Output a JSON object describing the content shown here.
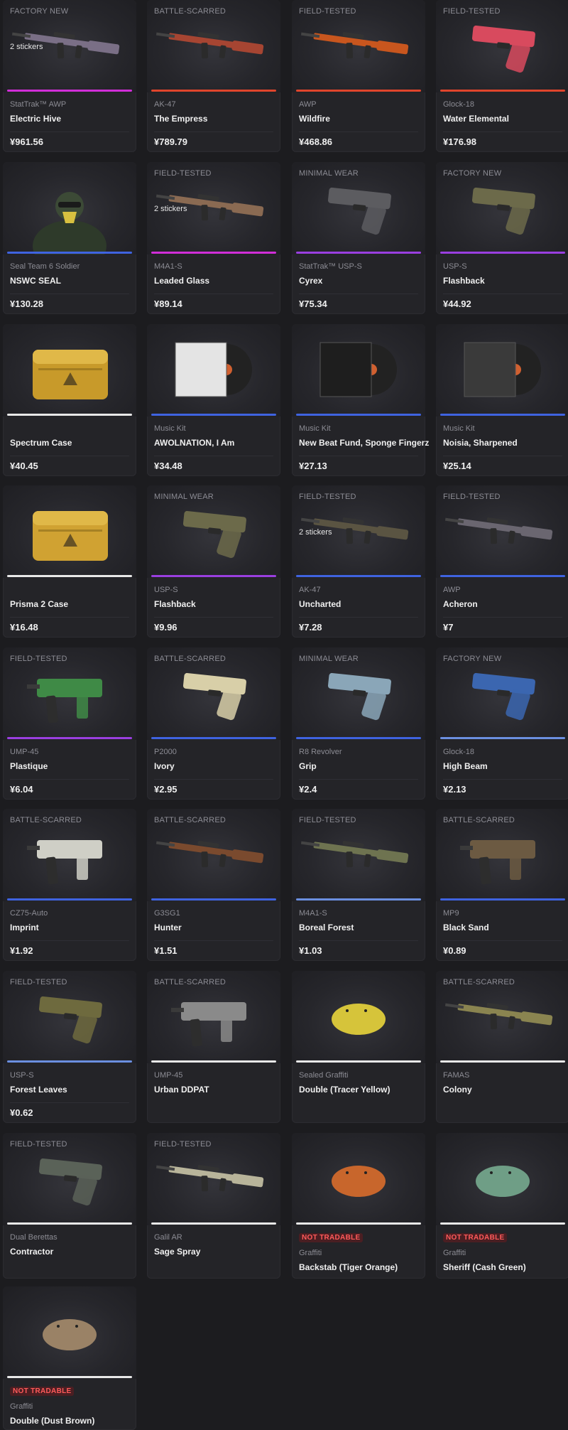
{
  "not_tradable_label": "NOT TRADABLE",
  "rarity_colors": {
    "pink": "#d12ed8",
    "red": "#e0452c",
    "purple": "#9a3fe0",
    "blue": "#3f63e0",
    "lightblue": "#6b8fe0",
    "white": "#e8e8e8"
  },
  "items": [
    {
      "wear": "FACTORY NEW",
      "stickers": "2 stickers",
      "type": "StatTrak™ AWP",
      "name": "Electric Hive",
      "price": "¥961.56",
      "rarity": "pink",
      "art": "rifle",
      "art_color": "#7a6f86"
    },
    {
      "wear": "BATTLE-SCARRED",
      "stickers": "",
      "type": "AK-47",
      "name": "The Empress",
      "price": "¥789.79",
      "rarity": "red",
      "art": "rifle",
      "art_color": "#a64532"
    },
    {
      "wear": "FIELD-TESTED",
      "stickers": "",
      "type": "AWP",
      "name": "Wildfire",
      "price": "¥468.86",
      "rarity": "red",
      "art": "rifle",
      "art_color": "#c8561e"
    },
    {
      "wear": "FIELD-TESTED",
      "stickers": "",
      "type": "Glock-18",
      "name": "Water Elemental",
      "price": "¥176.98",
      "rarity": "red",
      "art": "pistol",
      "art_color": "#d84a5e"
    },
    {
      "wear": "",
      "stickers": "",
      "type": "Seal Team 6 Soldier",
      "name": "NSWC SEAL",
      "price": "¥130.28",
      "rarity": "blue",
      "art": "agent",
      "art_color": "#3c4a36"
    },
    {
      "wear": "FIELD-TESTED",
      "stickers": "2 stickers",
      "type": "M4A1-S",
      "name": "Leaded Glass",
      "price": "¥89.14",
      "rarity": "pink",
      "art": "rifle",
      "art_color": "#8a6a52"
    },
    {
      "wear": "MINIMAL WEAR",
      "stickers": "",
      "type": "StatTrak™ USP-S",
      "name": "Cyrex",
      "price": "¥75.34",
      "rarity": "purple",
      "art": "pistol",
      "art_color": "#5c5c60"
    },
    {
      "wear": "FACTORY NEW",
      "stickers": "",
      "type": "USP-S",
      "name": "Flashback",
      "price": "¥44.92",
      "rarity": "purple",
      "art": "pistol",
      "art_color": "#6c6a4a"
    },
    {
      "wear": "",
      "stickers": "",
      "type": "",
      "name": "Spectrum Case",
      "price": "¥40.45",
      "rarity": "white",
      "art": "case",
      "art_color": "#c89a2a"
    },
    {
      "wear": "",
      "stickers": "",
      "type": "Music Kit",
      "name": "AWOLNATION, I Am",
      "price": "¥34.48",
      "rarity": "blue",
      "art": "music",
      "art_color": "#e4e4e4"
    },
    {
      "wear": "",
      "stickers": "",
      "type": "Music Kit",
      "name": "New Beat Fund, Sponge Fingerz",
      "price": "¥27.13",
      "rarity": "blue",
      "art": "music",
      "art_color": "#1e1e1e"
    },
    {
      "wear": "",
      "stickers": "",
      "type": "Music Kit",
      "name": "Noisia, Sharpened",
      "price": "¥25.14",
      "rarity": "blue",
      "art": "music",
      "art_color": "#3a3a3a"
    },
    {
      "wear": "",
      "stickers": "",
      "type": "",
      "name": "Prisma 2 Case",
      "price": "¥16.48",
      "rarity": "white",
      "art": "case",
      "art_color": "#d0a232"
    },
    {
      "wear": "MINIMAL WEAR",
      "stickers": "",
      "type": "USP-S",
      "name": "Flashback",
      "price": "¥9.96",
      "rarity": "purple",
      "art": "pistol",
      "art_color": "#6c6a4a"
    },
    {
      "wear": "FIELD-TESTED",
      "stickers": "2 stickers",
      "type": "AK-47",
      "name": "Uncharted",
      "price": "¥7.28",
      "rarity": "blue",
      "art": "rifle",
      "art_color": "#5a5442"
    },
    {
      "wear": "FIELD-TESTED",
      "stickers": "",
      "type": "AWP",
      "name": "Acheron",
      "price": "¥7",
      "rarity": "blue",
      "art": "rifle",
      "art_color": "#6a6670"
    },
    {
      "wear": "FIELD-TESTED",
      "stickers": "",
      "type": "UMP-45",
      "name": "Plastique",
      "price": "¥6.04",
      "rarity": "purple",
      "art": "smg",
      "art_color": "#3f8a46"
    },
    {
      "wear": "BATTLE-SCARRED",
      "stickers": "",
      "type": "P2000",
      "name": "Ivory",
      "price": "¥2.95",
      "rarity": "blue",
      "art": "pistol",
      "art_color": "#d8cfa8"
    },
    {
      "wear": "MINIMAL WEAR",
      "stickers": "",
      "type": "R8 Revolver",
      "name": "Grip",
      "price": "¥2.4",
      "rarity": "blue",
      "art": "pistol",
      "art_color": "#8aa6b8"
    },
    {
      "wear": "FACTORY NEW",
      "stickers": "",
      "type": "Glock-18",
      "name": "High Beam",
      "price": "¥2.13",
      "rarity": "lightblue",
      "art": "pistol",
      "art_color": "#3b66b0"
    },
    {
      "wear": "BATTLE-SCARRED",
      "stickers": "",
      "type": "CZ75-Auto",
      "name": "Imprint",
      "price": "¥1.92",
      "rarity": "blue",
      "art": "smg",
      "art_color": "#cfcfc6"
    },
    {
      "wear": "BATTLE-SCARRED",
      "stickers": "",
      "type": "G3SG1",
      "name": "Hunter",
      "price": "¥1.51",
      "rarity": "blue",
      "art": "rifle",
      "art_color": "#7a4a2e"
    },
    {
      "wear": "FIELD-TESTED",
      "stickers": "",
      "type": "M4A1-S",
      "name": "Boreal Forest",
      "price": "¥1.03",
      "rarity": "lightblue",
      "art": "rifle",
      "art_color": "#6e7350"
    },
    {
      "wear": "BATTLE-SCARRED",
      "stickers": "",
      "type": "MP9",
      "name": "Black Sand",
      "price": "¥0.89",
      "rarity": "blue",
      "art": "smg",
      "art_color": "#6c5a42"
    },
    {
      "wear": "FIELD-TESTED",
      "stickers": "",
      "type": "USP-S",
      "name": "Forest Leaves",
      "price": "¥0.62",
      "rarity": "lightblue",
      "art": "pistol",
      "art_color": "#6e6a3e"
    },
    {
      "wear": "BATTLE-SCARRED",
      "stickers": "",
      "type": "UMP-45",
      "name": "Urban DDPAT",
      "price": "",
      "rarity": "white",
      "art": "smg",
      "art_color": "#8a8a8a"
    },
    {
      "wear": "",
      "stickers": "",
      "type": "Sealed Graffiti",
      "name": "Double (Tracer Yellow)",
      "price": "",
      "rarity": "white",
      "art": "graffiti",
      "art_color": "#d6c43a"
    },
    {
      "wear": "BATTLE-SCARRED",
      "stickers": "",
      "type": "FAMAS",
      "name": "Colony",
      "price": "",
      "rarity": "white",
      "art": "rifle",
      "art_color": "#8a8450"
    },
    {
      "wear": "FIELD-TESTED",
      "stickers": "",
      "type": "Dual Berettas",
      "name": "Contractor",
      "price": "",
      "rarity": "white",
      "art": "pistol",
      "art_color": "#5a6258"
    },
    {
      "wear": "FIELD-TESTED",
      "stickers": "",
      "type": "Galil AR",
      "name": "Sage Spray",
      "price": "",
      "rarity": "white",
      "art": "rifle",
      "art_color": "#b8b49a"
    },
    {
      "wear": "",
      "stickers": "",
      "type": "Graffiti",
      "name": "Backstab (Tiger Orange)",
      "price": "",
      "rarity": "white",
      "art": "graffiti",
      "art_color": "#c8662c",
      "not_tradable": true
    },
    {
      "wear": "",
      "stickers": "",
      "type": "Graffiti",
      "name": "Sheriff (Cash Green)",
      "price": "",
      "rarity": "white",
      "art": "graffiti",
      "art_color": "#6f9e86",
      "not_tradable": true
    },
    {
      "wear": "",
      "stickers": "",
      "type": "Graffiti",
      "name": "Double (Dust Brown)",
      "price": "",
      "rarity": "white",
      "art": "graffiti",
      "art_color": "#9a8266",
      "not_tradable": true
    }
  ]
}
